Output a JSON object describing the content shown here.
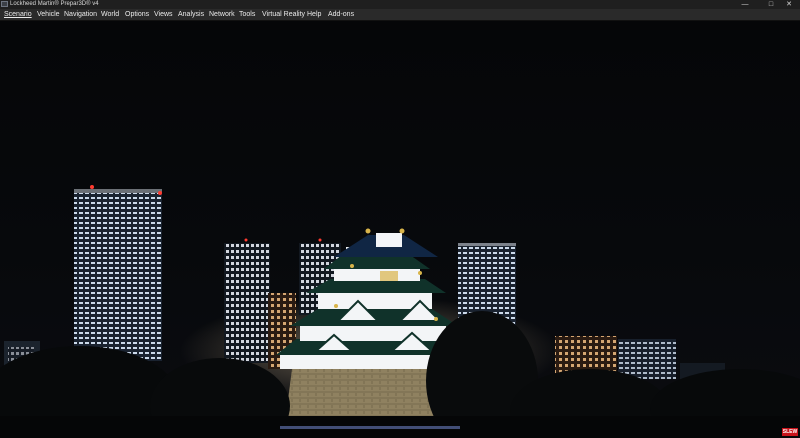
{
  "window": {
    "title": "Lockheed Martin® Prepar3D® v4",
    "controls": {
      "minimize": "—",
      "maximize": "□",
      "close": "✕"
    }
  },
  "menu": [
    "Scenario",
    "Vehicle",
    "Navigation",
    "World",
    "Options",
    "Views",
    "Analysis",
    "Network",
    "Tools",
    "Virtual Reality",
    "Help",
    "Add-ons"
  ],
  "badge": "SLEW",
  "icons": {
    "app": "prepar3d-app-icon",
    "scene": "osaka-castle-night-scene"
  },
  "colors": {
    "sky": "#050608",
    "castle_wall": "#f3f5f7",
    "roof": "#10322a",
    "gold": "#d8b44a",
    "city_light": "#d7e8ff",
    "badge": "#c8141b"
  }
}
